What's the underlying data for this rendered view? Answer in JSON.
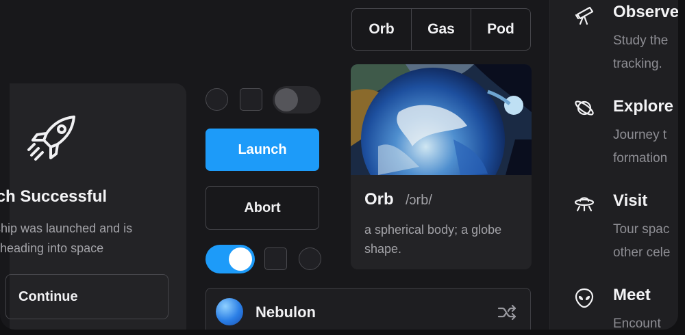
{
  "left_card": {
    "title": "nch Successful",
    "desc_line1": "ship was launched and is",
    "desc_line2": "heading into space",
    "continue_label": "Continue"
  },
  "controls": {
    "launch_label": "Launch",
    "abort_label": "Abort",
    "toggle_on": true,
    "toggle_off": false
  },
  "list_row": {
    "label": "Nebulon",
    "icon": "shuffle-icon"
  },
  "segmented": {
    "options": [
      "Orb",
      "Gas",
      "Pod"
    ]
  },
  "media_card": {
    "title": "Orb",
    "phonetic": "/ɔrb/",
    "description": "a spherical body; a globe shape."
  },
  "right_panel": {
    "items": [
      {
        "icon": "telescope-icon",
        "title": "Observe",
        "line1": "Study the",
        "line2": "tracking."
      },
      {
        "icon": "planet-icon",
        "title": "Explore",
        "line1": "Journey t",
        "line2": "formation"
      },
      {
        "icon": "ufo-icon",
        "title": "Visit",
        "line1": "Tour spac",
        "line2": "other cele"
      },
      {
        "icon": "alien-icon",
        "title": "Meet",
        "line1": "Encount",
        "line2": ""
      }
    ]
  },
  "colors": {
    "accent": "#1d9bf9",
    "background": "#18181b",
    "card": "#232326"
  }
}
